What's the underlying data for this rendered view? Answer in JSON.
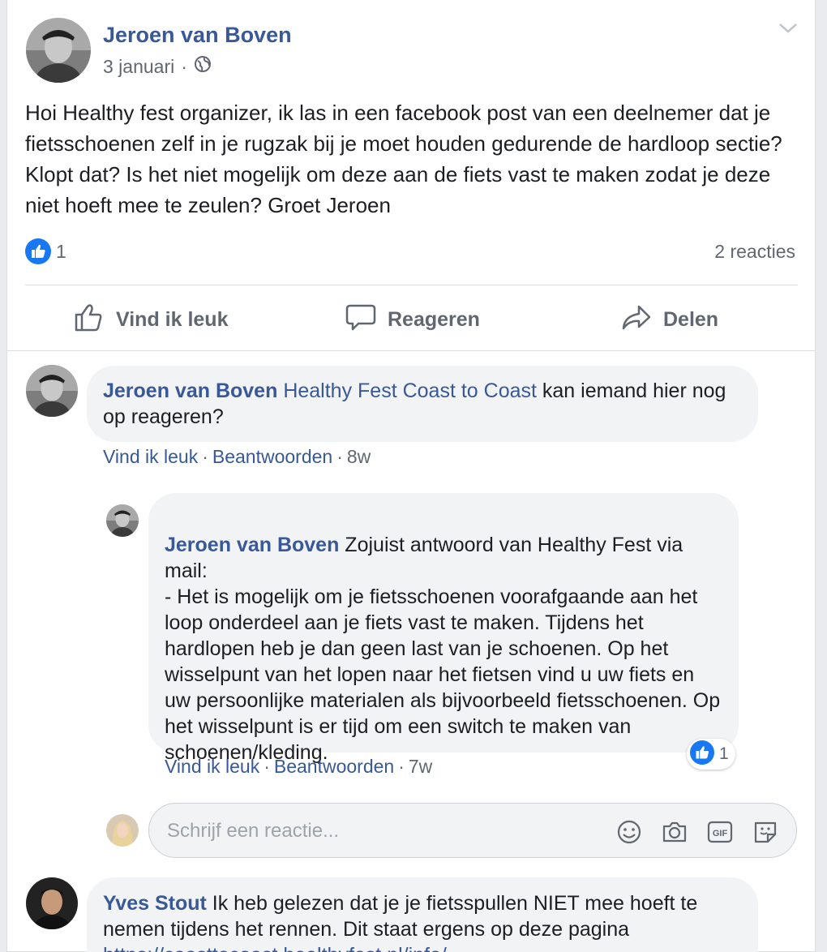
{
  "post": {
    "author": "Jeroen van Boven",
    "date": "3 januari",
    "separator": "·",
    "text": "Hoi Healthy fest organizer, ik las in een facebook post van een deelnemer dat je fietsschoenen zelf in je rugzak bij je moet houden gedurende de hardloop sectie? Klopt dat? Is het niet mogelijk om deze aan de fiets vast te maken zodat je deze niet hoeft mee te zeulen? Groet Jeroen",
    "like_count": "1",
    "comment_count": "2 reacties"
  },
  "actions": {
    "like": "Vind ik leuk",
    "comment": "Reageren",
    "share": "Delen"
  },
  "comments": [
    {
      "author": "Jeroen van Boven",
      "mention": "Healthy Fest Coast to Coast",
      "text": " kan iemand hier nog op reageren?",
      "like": "Vind ik leuk",
      "reply": "Beantwoorden",
      "time": "8w"
    },
    {
      "author": "Jeroen van Boven",
      "text": " Zojuist antwoord van Healthy Fest via mail:\n- Het is mogelijk om je fietsschoenen voorafgaande aan het loop onderdeel aan je fiets vast te maken. Tijdens het hardlopen heb je dan geen last van je schoenen. Op het wisselpunt van het lopen naar het fietsen vind u uw fiets en uw persoonlijke materialen als bijvoorbeeld fietsschoenen. Op het wisselpunt is er tijd om een switch te maken van schoenen/kleding.",
      "like": "Vind ik leuk",
      "reply": "Beantwoorden",
      "time": "7w",
      "reaction_count": "1"
    },
    {
      "author": "Yves Stout",
      "text": " Ik heb gelezen dat je je fietsspullen NIET mee hoeft te nemen tijdens het rennen. Dit staat ergens op deze pagina",
      "link": "https://coasttocoast.healthyfest.nl/info/"
    }
  ],
  "composer": {
    "placeholder": "Schrijf een reactie..."
  },
  "colors": {
    "link": "#385898",
    "like_blue": "#1877f2",
    "muted": "#606770"
  }
}
